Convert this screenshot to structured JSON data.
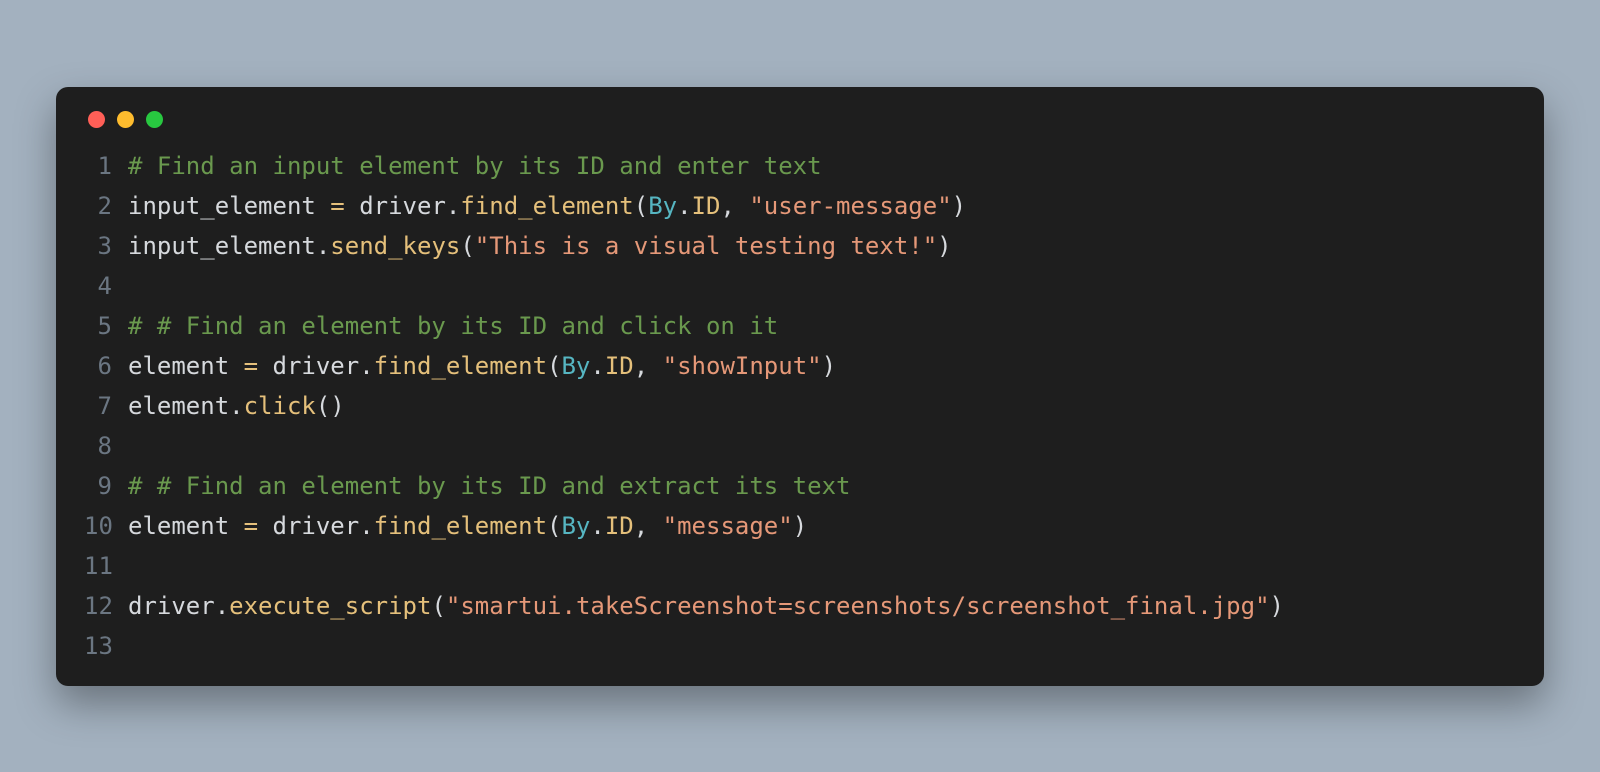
{
  "window": {
    "traffic": {
      "red": "#ff5f57",
      "yellow": "#febc2e",
      "green": "#28c840"
    }
  },
  "code": {
    "lines": [
      {
        "n": "1",
        "tokens": [
          {
            "c": "t-comment",
            "t": "# Find an input element by its ID and enter text"
          }
        ]
      },
      {
        "n": "2",
        "tokens": [
          {
            "c": "t-fg",
            "t": "input_element "
          },
          {
            "c": "t-attr",
            "t": "="
          },
          {
            "c": "t-fg",
            "t": " driver."
          },
          {
            "c": "t-attr",
            "t": "find_element"
          },
          {
            "c": "t-fg",
            "t": "("
          },
          {
            "c": "t-type",
            "t": "By"
          },
          {
            "c": "t-fg",
            "t": "."
          },
          {
            "c": "t-attr",
            "t": "ID"
          },
          {
            "c": "t-fg",
            "t": ", "
          },
          {
            "c": "t-string",
            "t": "\"user-message\""
          },
          {
            "c": "t-fg",
            "t": ")"
          }
        ]
      },
      {
        "n": "3",
        "tokens": [
          {
            "c": "t-fg",
            "t": "input_element."
          },
          {
            "c": "t-attr",
            "t": "send_keys"
          },
          {
            "c": "t-fg",
            "t": "("
          },
          {
            "c": "t-string",
            "t": "\"This is a visual testing text!\""
          },
          {
            "c": "t-fg",
            "t": ")"
          }
        ]
      },
      {
        "n": "4",
        "tokens": []
      },
      {
        "n": "5",
        "tokens": [
          {
            "c": "t-comment",
            "t": "# # Find an element by its ID and click on it"
          }
        ]
      },
      {
        "n": "6",
        "tokens": [
          {
            "c": "t-fg",
            "t": "element "
          },
          {
            "c": "t-attr",
            "t": "="
          },
          {
            "c": "t-fg",
            "t": " driver."
          },
          {
            "c": "t-attr",
            "t": "find_element"
          },
          {
            "c": "t-fg",
            "t": "("
          },
          {
            "c": "t-type",
            "t": "By"
          },
          {
            "c": "t-fg",
            "t": "."
          },
          {
            "c": "t-attr",
            "t": "ID"
          },
          {
            "c": "t-fg",
            "t": ", "
          },
          {
            "c": "t-string",
            "t": "\"showInput\""
          },
          {
            "c": "t-fg",
            "t": ")"
          }
        ]
      },
      {
        "n": "7",
        "tokens": [
          {
            "c": "t-fg",
            "t": "element."
          },
          {
            "c": "t-attr",
            "t": "click"
          },
          {
            "c": "t-fg",
            "t": "()"
          }
        ]
      },
      {
        "n": "8",
        "tokens": []
      },
      {
        "n": "9",
        "tokens": [
          {
            "c": "t-comment",
            "t": "# # Find an element by its ID and extract its text"
          }
        ]
      },
      {
        "n": "10",
        "tokens": [
          {
            "c": "t-fg",
            "t": "element "
          },
          {
            "c": "t-attr",
            "t": "="
          },
          {
            "c": "t-fg",
            "t": " driver."
          },
          {
            "c": "t-attr",
            "t": "find_element"
          },
          {
            "c": "t-fg",
            "t": "("
          },
          {
            "c": "t-type",
            "t": "By"
          },
          {
            "c": "t-fg",
            "t": "."
          },
          {
            "c": "t-attr",
            "t": "ID"
          },
          {
            "c": "t-fg",
            "t": ", "
          },
          {
            "c": "t-string",
            "t": "\"message\""
          },
          {
            "c": "t-fg",
            "t": ")"
          }
        ]
      },
      {
        "n": "11",
        "tokens": []
      },
      {
        "n": "12",
        "tokens": [
          {
            "c": "t-fg",
            "t": "driver."
          },
          {
            "c": "t-attr",
            "t": "execute_script"
          },
          {
            "c": "t-fg",
            "t": "("
          },
          {
            "c": "t-string",
            "t": "\"smartui.takeScreenshot=screenshots/screenshot_final.jpg\""
          },
          {
            "c": "t-fg",
            "t": ")"
          }
        ]
      },
      {
        "n": "13",
        "tokens": []
      }
    ]
  }
}
